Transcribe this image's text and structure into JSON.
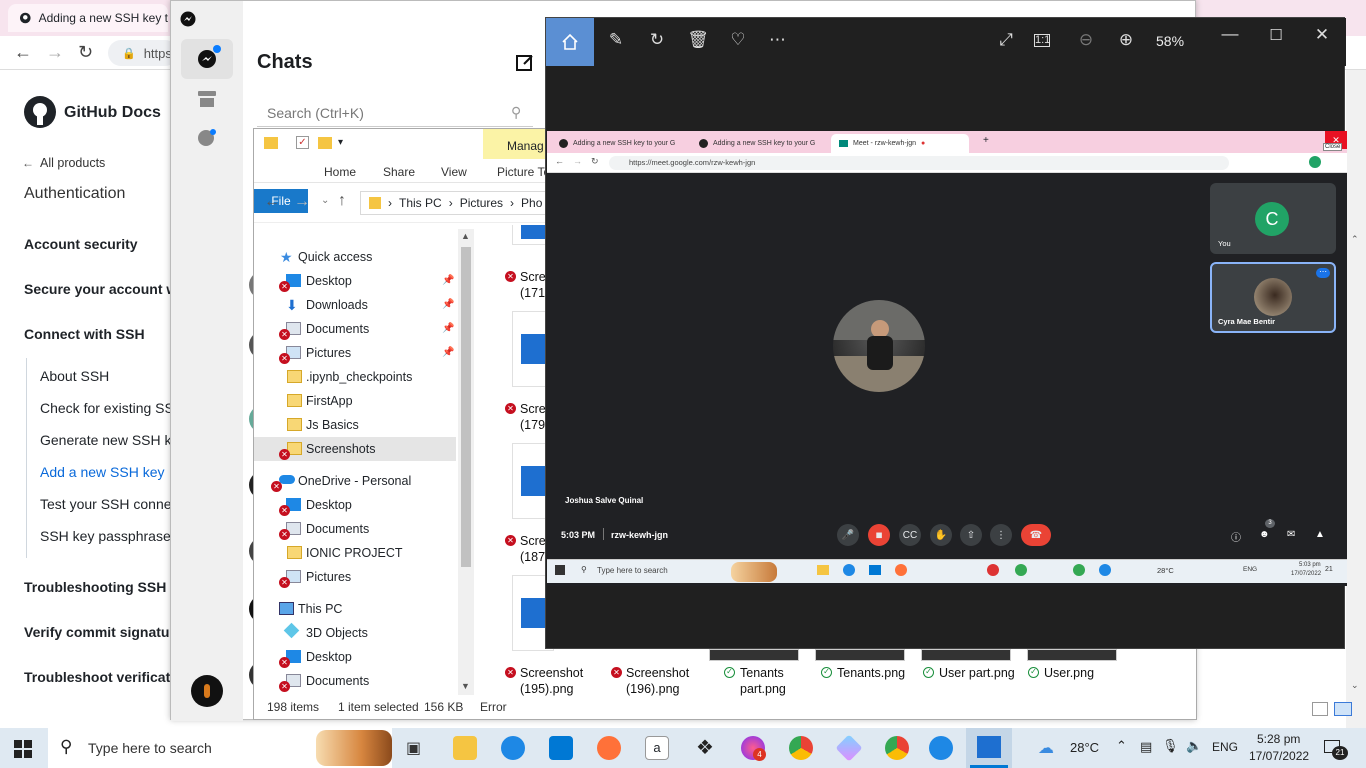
{
  "github": {
    "tab_title": "Adding a new SSH key t",
    "url_fragment": "https",
    "brand": "GitHub Docs",
    "all_products": "All products",
    "section": "Authentication",
    "nav": [
      {
        "label": "Account security"
      },
      {
        "label": "Secure your account wi"
      },
      {
        "label": "Connect with SSH"
      },
      {
        "label": "Troubleshooting SSH"
      },
      {
        "label": "Verify commit signatur"
      },
      {
        "label": "Troubleshoot verificatio"
      }
    ],
    "subnav": [
      {
        "label": "About SSH"
      },
      {
        "label": "Check for existing SS"
      },
      {
        "label": "Generate new SSH ke"
      },
      {
        "label": "Add a new SSH key"
      },
      {
        "label": "Test your SSH connec"
      },
      {
        "label": "SSH key passphrases"
      }
    ]
  },
  "messenger": {
    "title": "Chats",
    "search_placeholder": "Search (Ctrl+K)"
  },
  "explorer": {
    "ribbon_tabs": [
      "File",
      "Home",
      "Share",
      "View"
    ],
    "manage_label": "Manag",
    "picture_tools": "Picture To",
    "path": [
      "This PC",
      "Pictures",
      "Pho"
    ],
    "tree": [
      {
        "label": "Quick access"
      },
      {
        "label": "Desktop"
      },
      {
        "label": "Downloads"
      },
      {
        "label": "Documents"
      },
      {
        "label": "Pictures"
      },
      {
        "label": ".ipynb_checkpoints"
      },
      {
        "label": "FirstApp"
      },
      {
        "label": "Js Basics"
      },
      {
        "label": "Screenshots"
      },
      {
        "label": "OneDrive - Personal"
      },
      {
        "label": "Desktop"
      },
      {
        "label": "Documents"
      },
      {
        "label": "IONIC PROJECT"
      },
      {
        "label": "Pictures"
      },
      {
        "label": "This PC"
      },
      {
        "label": "3D Objects"
      },
      {
        "label": "Desktop"
      },
      {
        "label": "Documents"
      }
    ],
    "files_col1": [
      {
        "line1": "Scree",
        "line2": "(171)"
      },
      {
        "line1": "Scree",
        "line2": "(179)"
      },
      {
        "line1": "Scree",
        "line2": "(187)"
      }
    ],
    "bottom_files": [
      {
        "line1": "Screenshot",
        "line2": "(195).png",
        "status": "error"
      },
      {
        "line1": "Screenshot",
        "line2": "(196).png",
        "status": "error"
      },
      {
        "line1": "Tenants",
        "line2": "part.png",
        "status": "ok"
      },
      {
        "line1": "Tenants.png",
        "line2": "",
        "status": "ok"
      },
      {
        "line1": "User part.png",
        "line2": "",
        "status": "ok"
      },
      {
        "line1": "User.png",
        "line2": "",
        "status": "ok"
      }
    ],
    "status": {
      "items": "198 items",
      "selected": "1 item selected",
      "size": "156 KB",
      "error": "Error"
    }
  },
  "photos": {
    "zoom": "58%"
  },
  "screenshot": {
    "tabs": [
      {
        "label": "Adding a new SSH key to your G"
      },
      {
        "label": "Adding a new SSH key to your G"
      },
      {
        "label": "Meet - rzw-kewh-jgn"
      }
    ],
    "url": "https://meet.google.com/rzw-kewh-jgn",
    "close_tooltip": "Close",
    "participant_you": "You",
    "you_initial": "C",
    "participant_other": "Cyra Mae Bentir",
    "speaker_name": "Joshua Salve Quinal",
    "meet_time": "5:03 PM",
    "meet_code": "rzw-kewh-jgn",
    "people_count": "3",
    "mini_search": "Type here to search",
    "mini_temp": "28°C",
    "mini_lang": "ENG",
    "mini_time": "5:03 pm",
    "mini_date": "17/07/2022",
    "mini_notif": "21"
  },
  "taskbar": {
    "search_placeholder": "Type here to search",
    "temperature": "28°C",
    "language": "ENG",
    "time": "5:28 pm",
    "date": "17/07/2022",
    "notifications": "21",
    "badge_count": "4"
  }
}
